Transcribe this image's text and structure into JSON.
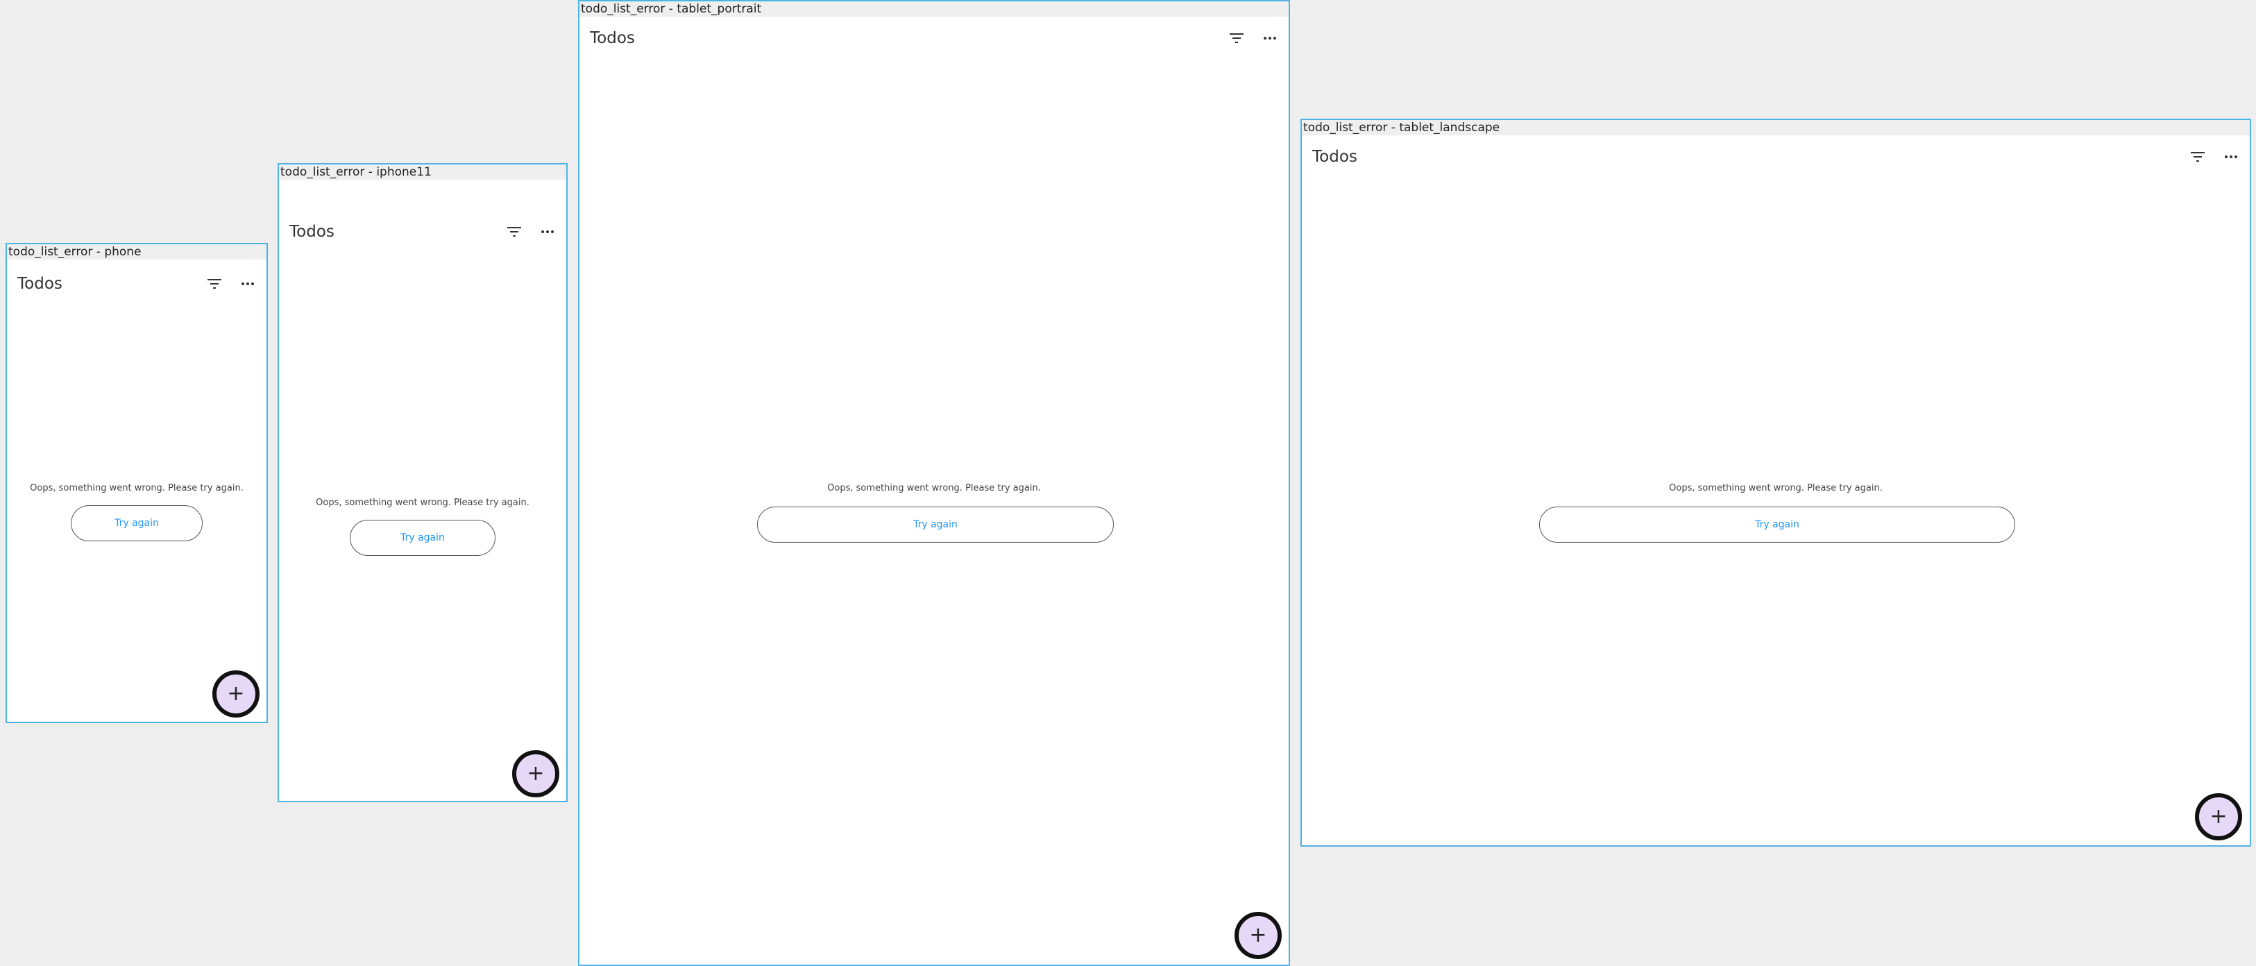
{
  "frames": {
    "phone": {
      "label": "todo_list_error - phone",
      "title": "Todos",
      "error_message": "Oops, something went wrong. Please try again.",
      "retry_label": "Try again",
      "fab_symbol": "+"
    },
    "iphone11": {
      "label": "todo_list_error - iphone11",
      "title": "Todos",
      "error_message": "Oops, something went wrong. Please try again.",
      "retry_label": "Try again",
      "fab_symbol": "+"
    },
    "tablet_portrait": {
      "label": "todo_list_error - tablet_portrait",
      "title": "Todos",
      "error_message": "Oops, something went wrong. Please try again.",
      "retry_label": "Try again",
      "fab_symbol": "+"
    },
    "tablet_landscape": {
      "label": "todo_list_error - tablet_landscape",
      "title": "Todos",
      "error_message": "Oops, something went wrong. Please try again.",
      "retry_label": "Try again",
      "fab_symbol": "+"
    }
  },
  "icons": {
    "filter": "filter-list-icon",
    "more": "more-horizontal-icon",
    "add": "add-icon"
  },
  "colors": {
    "frame_border": "#4fb3e6",
    "retry_text": "#2196f3",
    "fab_fill": "#e6d8f7",
    "fab_border": "#111111"
  }
}
